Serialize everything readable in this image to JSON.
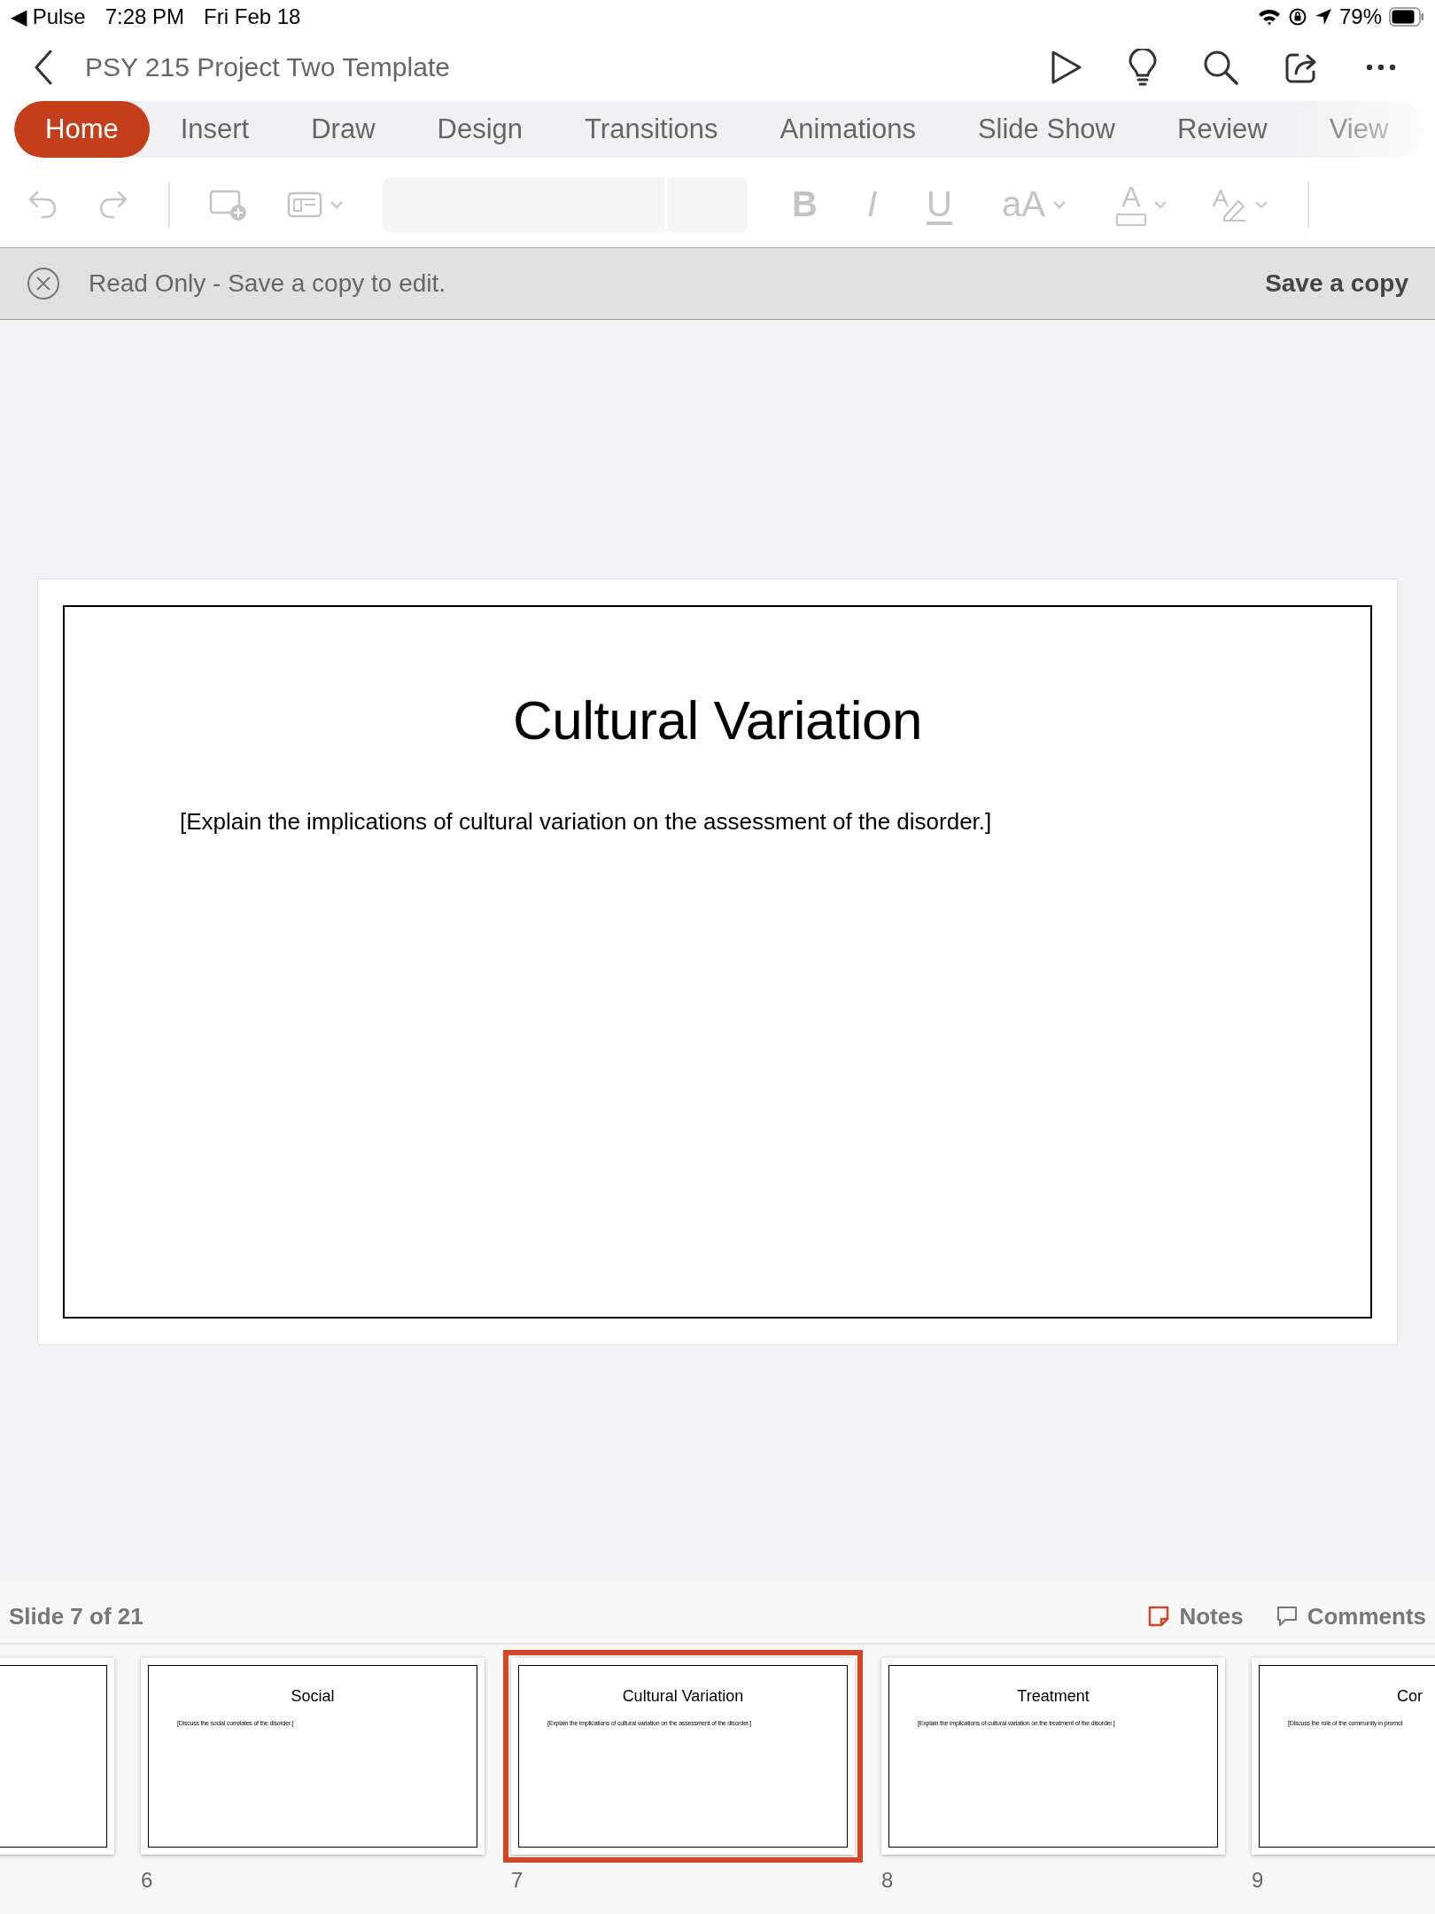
{
  "status_bar": {
    "back_app": "◀ Pulse",
    "time": "7:28 PM",
    "date": "Fri Feb 18",
    "battery_text": "79%"
  },
  "document": {
    "title": "PSY 215 Project Two Template"
  },
  "ribbon_tabs": [
    {
      "label": "Home",
      "selected": true
    },
    {
      "label": "Insert",
      "selected": false
    },
    {
      "label": "Draw",
      "selected": false
    },
    {
      "label": "Design",
      "selected": false
    },
    {
      "label": "Transitions",
      "selected": false
    },
    {
      "label": "Animations",
      "selected": false
    },
    {
      "label": "Slide Show",
      "selected": false
    },
    {
      "label": "Review",
      "selected": false
    },
    {
      "label": "View",
      "selected": false
    }
  ],
  "toolbar": [
    {
      "kind": "undo",
      "disabled": true
    },
    {
      "kind": "redo",
      "disabled": true
    },
    {
      "kind": "divider"
    },
    {
      "kind": "new-slide",
      "disabled": true
    },
    {
      "kind": "layout",
      "disabled": true
    },
    {
      "kind": "font-field"
    },
    {
      "kind": "size-field"
    },
    {
      "kind": "bold",
      "label": "B",
      "disabled": true
    },
    {
      "kind": "italic",
      "label": "I",
      "disabled": true
    },
    {
      "kind": "underline",
      "label": "U",
      "disabled": true
    },
    {
      "kind": "font-size",
      "label": "aA",
      "disabled": true
    },
    {
      "kind": "font-color",
      "label": "A",
      "disabled": true
    },
    {
      "kind": "highlighter",
      "disabled": true
    },
    {
      "kind": "divider"
    }
  ],
  "banner": {
    "message": "Read Only - Save a copy to edit.",
    "action": "Save a copy"
  },
  "slide": {
    "title": "Cultural Variation",
    "body": "[Explain the implications of cultural variation on the assessment of the disorder.]"
  },
  "footer": {
    "slide_counter": "Slide 7 of 21",
    "notes": "Notes",
    "comments": "Comments"
  },
  "thumbnails": [
    {
      "kind": "cut",
      "selected": false
    },
    {
      "kind": "full",
      "number": "6",
      "title": "Social",
      "body": "[Discuss the social correlates of the disorder.]",
      "selected": false
    },
    {
      "kind": "full",
      "number": "7",
      "title": "Cultural Variation",
      "body": "[Explain the implications of cultural variation on the assessment of the disorder.]",
      "selected": true
    },
    {
      "kind": "full",
      "number": "8",
      "title": "Treatment",
      "body": "[Explain the implications of cultural variation on the treatment of the disorder.]",
      "selected": false
    },
    {
      "kind": "edge",
      "number": "9",
      "title": "Cor",
      "body": "[Discuss the role of the community in promot",
      "selected": false
    }
  ]
}
